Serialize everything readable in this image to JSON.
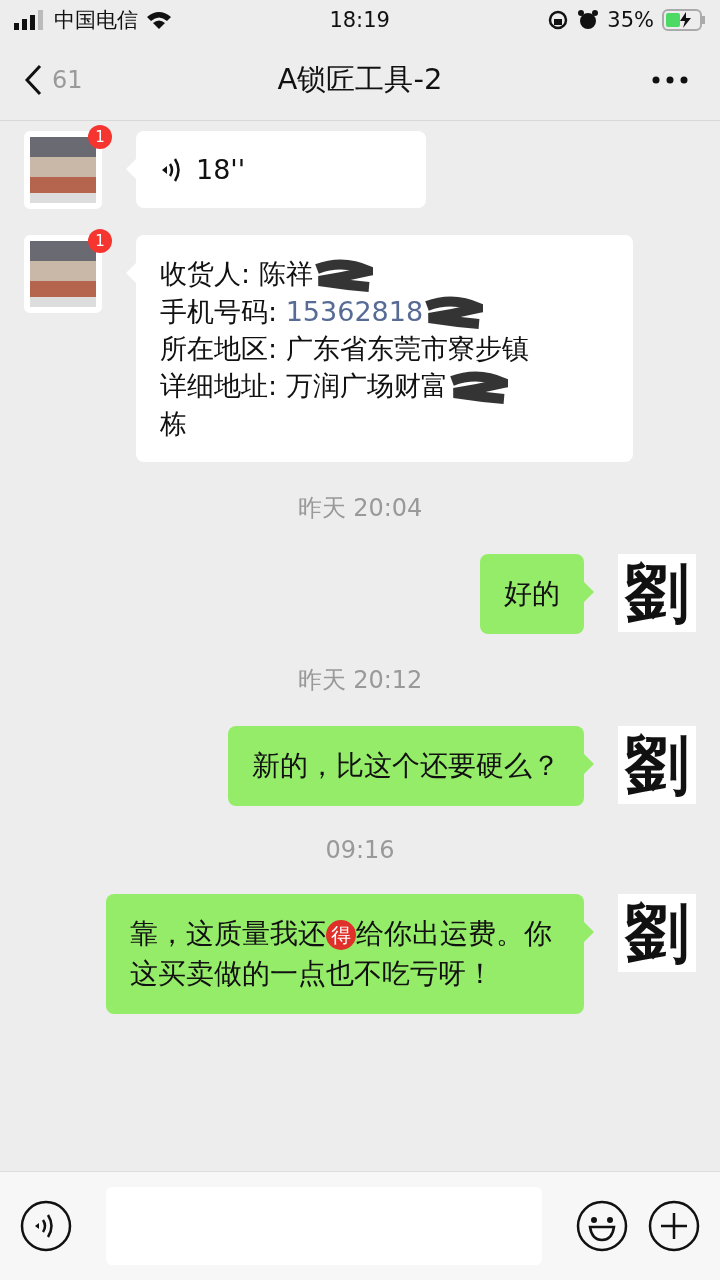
{
  "status_bar": {
    "carrier": "中国电信",
    "time": "18:19",
    "battery": "35%"
  },
  "nav": {
    "back_count": "61",
    "title": "A锁匠工具-2"
  },
  "messages": [
    {
      "kind": "voice",
      "badge": "1",
      "duration": "18''"
    },
    {
      "kind": "address",
      "badge": "1",
      "lines": [
        {
          "label": "收货人: ",
          "value": "陈祥",
          "redacted": true,
          "link": false
        },
        {
          "label": "手机号码: ",
          "value": "15362818",
          "redacted": true,
          "link": true
        },
        {
          "label": "所在地区: ",
          "value": "广东省东莞市寮步镇",
          "redacted": false,
          "link": false
        },
        {
          "label": "详细地址: ",
          "value": "万润广场财富",
          "redacted": true,
          "link": false
        }
      ],
      "tail": "栋"
    },
    {
      "kind": "time",
      "text": "昨天 20:04"
    },
    {
      "kind": "text",
      "avatar": "劉",
      "text": "好的"
    },
    {
      "kind": "time",
      "text": "昨天 20:12"
    },
    {
      "kind": "text",
      "avatar": "劉",
      "text": "新的，比这个还要硬么？"
    },
    {
      "kind": "time",
      "text": "09:16"
    },
    {
      "kind": "emoji_text",
      "avatar": "劉",
      "before": "靠，这质量我还",
      "emoji": "得",
      "after": "给你出运费。你这买卖做的一点也不吃亏呀！"
    }
  ]
}
